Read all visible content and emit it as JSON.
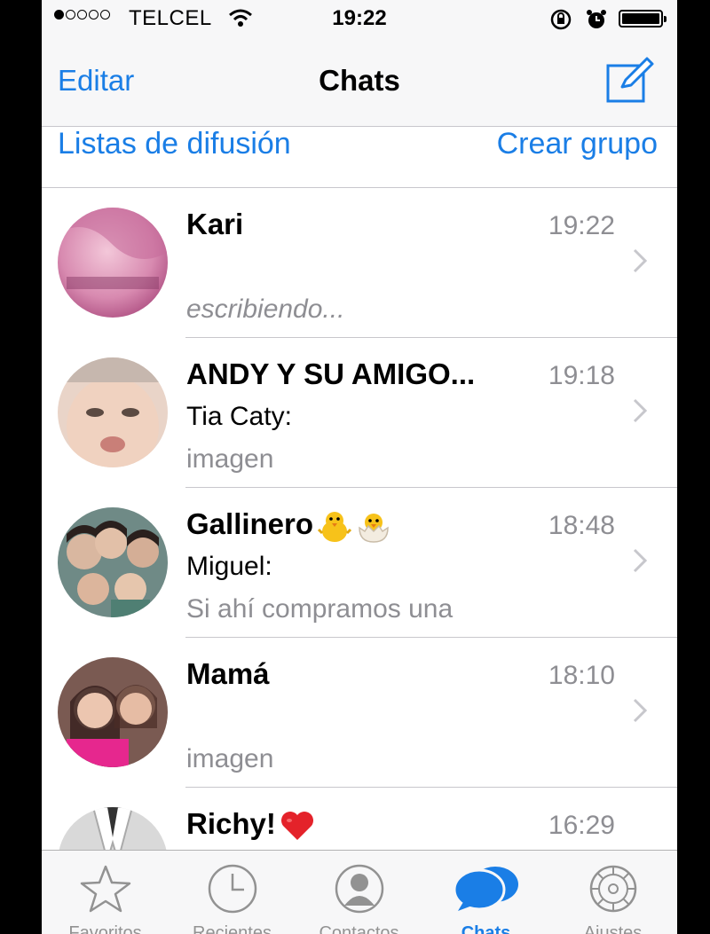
{
  "status_bar": {
    "carrier": "TELCEL",
    "time": "19:22",
    "signal_bars": 1,
    "signal_total": 5
  },
  "nav": {
    "edit_label": "Editar",
    "title": "Chats",
    "compose_icon": "compose-icon"
  },
  "subbar": {
    "broadcast_label": "Listas de difusión",
    "new_group_label": "Crear grupo"
  },
  "chats": [
    {
      "name": "Kari",
      "time": "19:22",
      "sender": "",
      "preview": "escribiendo..."
    },
    {
      "name": "ANDY Y SU AMIGO...",
      "time": "19:18",
      "sender": "Tia Caty:",
      "preview": "imagen"
    },
    {
      "name": "Gallinero",
      "time": "18:48",
      "sender": "Miguel:",
      "preview": "Si ahí compramos una"
    },
    {
      "name": "Mamá",
      "time": "18:10",
      "sender": "",
      "preview": "imagen"
    },
    {
      "name": "Richy!",
      "time": "16:29",
      "sender": "",
      "preview": ""
    }
  ],
  "tabs": [
    {
      "label": "Favoritos",
      "icon": "star-icon",
      "active": false
    },
    {
      "label": "Recientes",
      "icon": "clock-icon",
      "active": false
    },
    {
      "label": "Contactos",
      "icon": "person-icon",
      "active": false
    },
    {
      "label": "Chats",
      "icon": "chat-bubbles-icon",
      "active": true
    },
    {
      "label": "Ajustes",
      "icon": "gear-icon",
      "active": false
    }
  ],
  "colors": {
    "accent": "#1a7ee6",
    "secondary_text": "#8e8e93",
    "bar_bg": "#f7f7f8"
  }
}
